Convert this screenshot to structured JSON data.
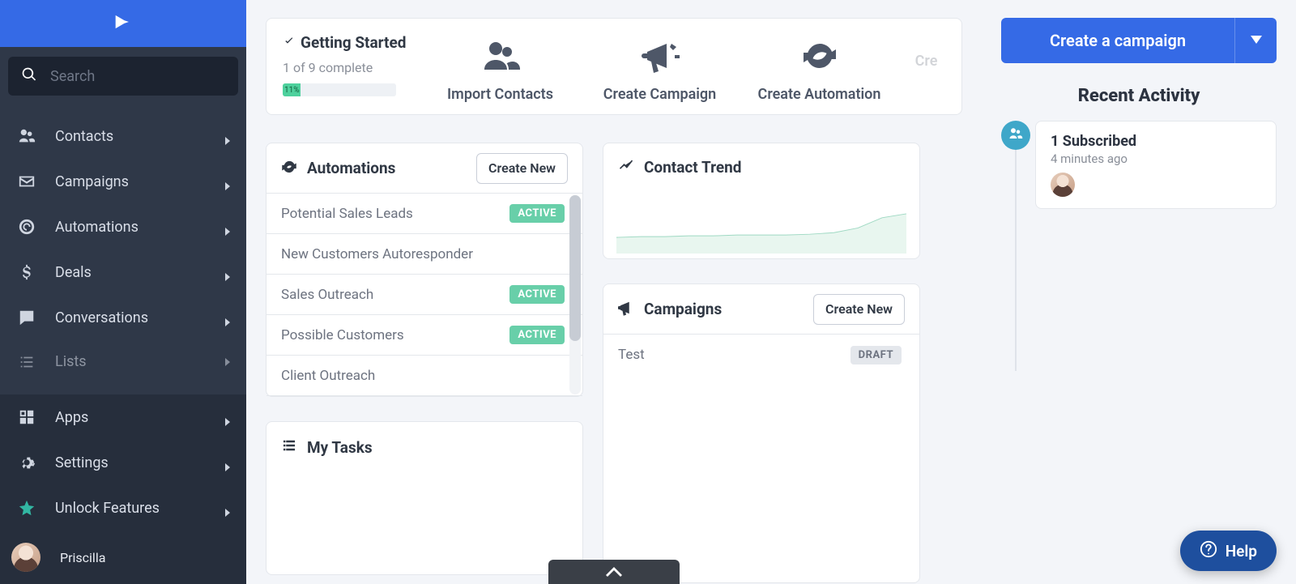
{
  "sidebar": {
    "search_placeholder": "Search",
    "nav": [
      {
        "label": "Contacts",
        "icon": "contacts"
      },
      {
        "label": "Campaigns",
        "icon": "mail"
      },
      {
        "label": "Automations",
        "icon": "automation"
      },
      {
        "label": "Deals",
        "icon": "dollar"
      },
      {
        "label": "Conversations",
        "icon": "chat"
      },
      {
        "label": "Lists",
        "icon": "list",
        "cut": true
      }
    ],
    "bottom": [
      {
        "label": "Apps",
        "icon": "apps"
      },
      {
        "label": "Settings",
        "icon": "gear"
      },
      {
        "label": "Unlock Features",
        "icon": "star",
        "teal": true
      }
    ],
    "user": {
      "name": "Priscilla"
    }
  },
  "getting_started": {
    "title": "Getting Started",
    "progress_text": "1 of 9 complete",
    "progress_pct": 11,
    "progress_label": "11%",
    "actions": [
      {
        "label": "Import Contacts",
        "icon": "people"
      },
      {
        "label": "Create Campaign",
        "icon": "megaphone"
      },
      {
        "label": "Create Automation",
        "icon": "refresh"
      }
    ],
    "faded_label": "Cre"
  },
  "automations_panel": {
    "title": "Automations",
    "create_label": "Create New",
    "items": [
      {
        "name": "Potential Sales Leads",
        "status": "ACTIVE"
      },
      {
        "name": "New Customers Autoresponder",
        "status": ""
      },
      {
        "name": "Sales Outreach",
        "status": "ACTIVE"
      },
      {
        "name": "Possible Customers",
        "status": "ACTIVE"
      },
      {
        "name": "Client Outreach",
        "status": ""
      }
    ]
  },
  "contact_trend": {
    "title": "Contact Trend"
  },
  "campaigns_panel": {
    "title": "Campaigns",
    "create_label": "Create New",
    "items": [
      {
        "name": "Test",
        "status": "DRAFT"
      }
    ]
  },
  "my_tasks": {
    "title": "My Tasks"
  },
  "rail": {
    "cta_label": "Create a campaign",
    "recent_title": "Recent Activity",
    "activity": [
      {
        "title": "1 Subscribed",
        "time": "4 minutes ago"
      }
    ]
  },
  "help_label": "Help",
  "chart_data": {
    "type": "line",
    "title": "Contact Trend",
    "xlabel": "",
    "ylabel": "",
    "x": [
      0,
      1,
      2,
      3,
      4,
      5,
      6,
      7,
      8,
      9,
      10,
      11
    ],
    "values": [
      30,
      31,
      31,
      32,
      32,
      33,
      33,
      33,
      34,
      36,
      40,
      48
    ],
    "ylim": [
      0,
      60
    ]
  }
}
